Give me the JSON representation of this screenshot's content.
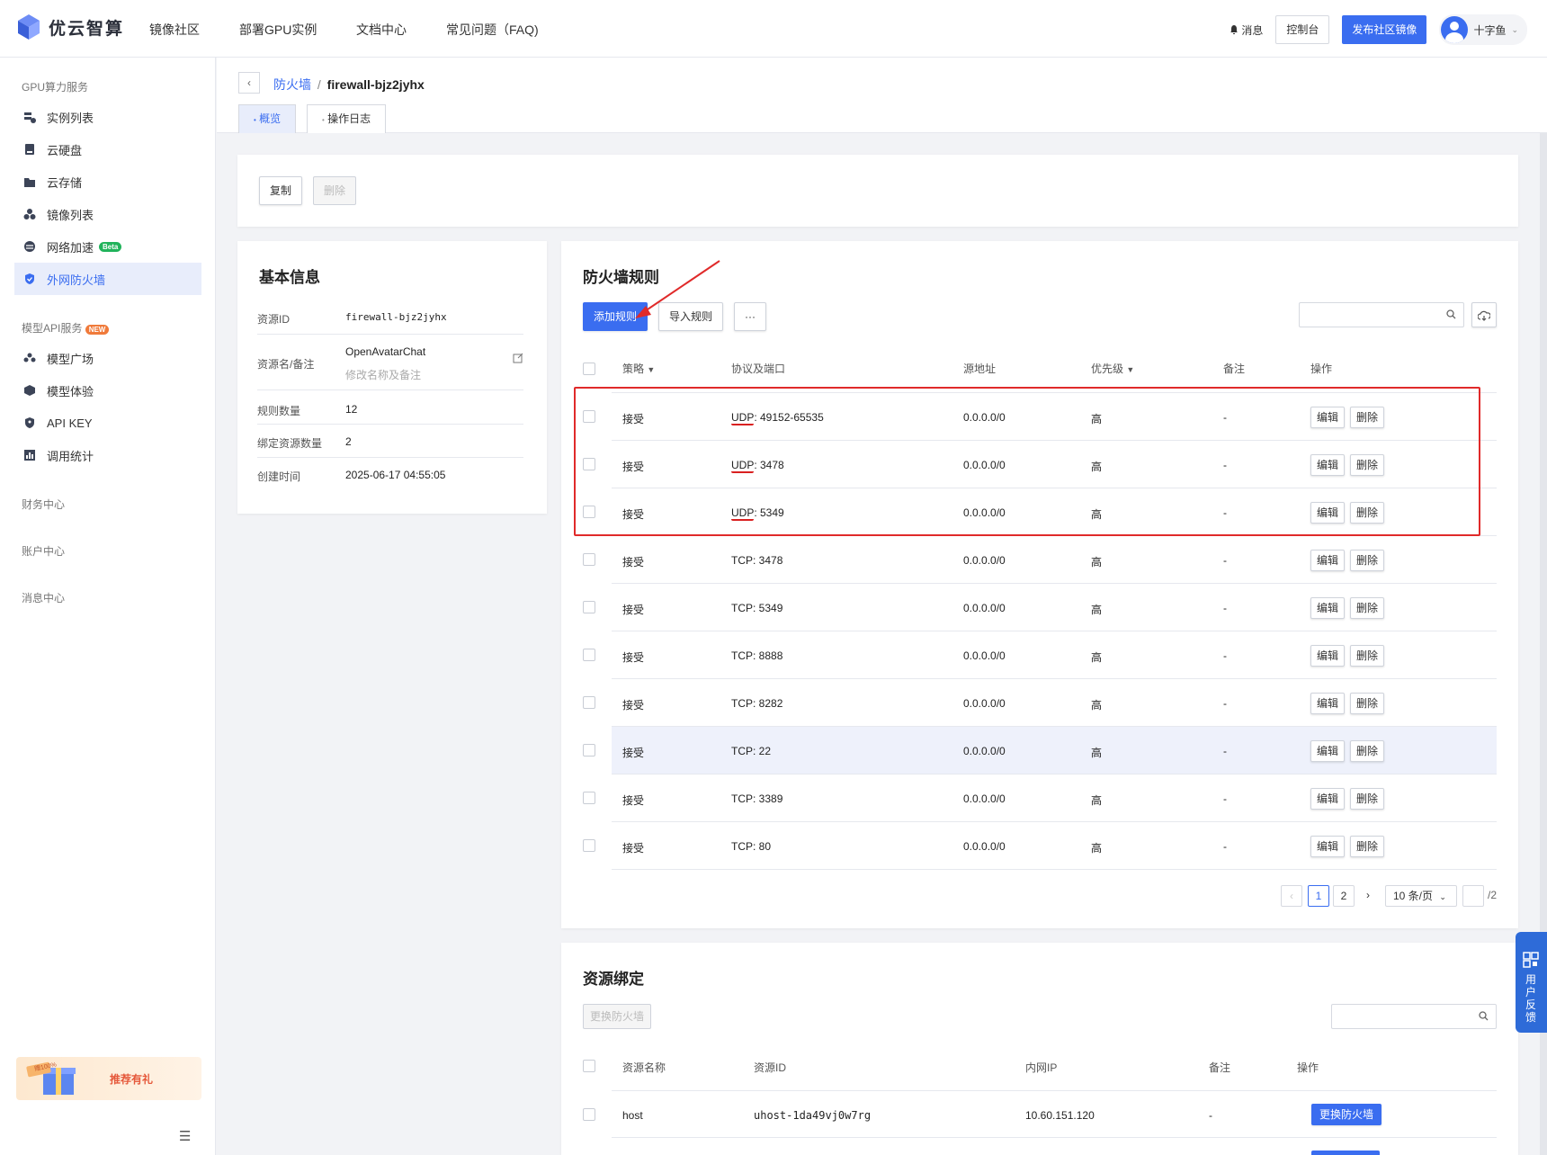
{
  "brand": {
    "name": "优云智算"
  },
  "nav": [
    {
      "label": "镜像社区"
    },
    {
      "label": "部署GPU实例"
    },
    {
      "label": "文档中心"
    },
    {
      "label": "常见问题（FAQ)"
    }
  ],
  "topright": {
    "messages": "消息",
    "console": "控制台",
    "publish": "发布社区镜像",
    "user": "十字鱼"
  },
  "sidebar": {
    "gpu_title": "GPU算力服务",
    "gpu_items": [
      {
        "label": "实例列表"
      },
      {
        "label": "云硬盘"
      },
      {
        "label": "云存储"
      },
      {
        "label": "镜像列表"
      },
      {
        "label": "网络加速",
        "badge": "Beta"
      },
      {
        "label": "外网防火墙",
        "active": true
      }
    ],
    "api_title": "模型API服务",
    "api_badge": "NEW",
    "api_items": [
      {
        "label": "模型广场"
      },
      {
        "label": "模型体验"
      },
      {
        "label": "API KEY"
      },
      {
        "label": "调用统计"
      }
    ],
    "finance": "财务中心",
    "account": "账户中心",
    "message": "消息中心",
    "promo": "推荐有礼",
    "promo_tag": "赠100%"
  },
  "header": {
    "breadcrumb_parent": "防火墙",
    "breadcrumb_sep": "/",
    "breadcrumb_current": "firewall-bjz2jyhx",
    "tabs": [
      {
        "label": "概览"
      },
      {
        "label": "操作日志"
      }
    ]
  },
  "actions": {
    "copy": "复制",
    "delete": "删除"
  },
  "basic_info": {
    "title": "基本信息",
    "resource_id_label": "资源ID",
    "resource_id": "firewall-bjz2jyhx",
    "name_label": "资源名/备注",
    "name": "OpenAvatarChat",
    "name_hint": "修改名称及备注",
    "rule_count_label": "规则数量",
    "rule_count": "12",
    "bound_label": "绑定资源数量",
    "bound": "2",
    "created_label": "创建时间",
    "created": "2025-06-17 04:55:05"
  },
  "rules": {
    "title": "防火墙规则",
    "add": "添加规则",
    "import": "导入规则",
    "more": "···",
    "columns": {
      "policy": "策略",
      "proto": "协议及端口",
      "source": "源地址",
      "priority": "优先级",
      "remark": "备注",
      "ops": "操作"
    },
    "edit": "编辑",
    "del": "删除",
    "rows": [
      {
        "policy": "接受",
        "proto": "UDP",
        "port": ": 49152-65535",
        "source": "0.0.0.0/0",
        "priority": "高",
        "remark": "-"
      },
      {
        "policy": "接受",
        "proto": "UDP",
        "port": ": 3478",
        "source": "0.0.0.0/0",
        "priority": "高",
        "remark": "-"
      },
      {
        "policy": "接受",
        "proto": "UDP",
        "port": ": 5349",
        "source": "0.0.0.0/0",
        "priority": "高",
        "remark": "-"
      },
      {
        "policy": "接受",
        "proto": "TCP",
        "port": ": 3478",
        "source": "0.0.0.0/0",
        "priority": "高",
        "remark": "-"
      },
      {
        "policy": "接受",
        "proto": "TCP",
        "port": ": 5349",
        "source": "0.0.0.0/0",
        "priority": "高",
        "remark": "-"
      },
      {
        "policy": "接受",
        "proto": "TCP",
        "port": ": 8888",
        "source": "0.0.0.0/0",
        "priority": "高",
        "remark": "-"
      },
      {
        "policy": "接受",
        "proto": "TCP",
        "port": ": 8282",
        "source": "0.0.0.0/0",
        "priority": "高",
        "remark": "-"
      },
      {
        "policy": "接受",
        "proto": "TCP",
        "port": ": 22",
        "source": "0.0.0.0/0",
        "priority": "高",
        "remark": "-"
      },
      {
        "policy": "接受",
        "proto": "TCP",
        "port": ": 3389",
        "source": "0.0.0.0/0",
        "priority": "高",
        "remark": "-"
      },
      {
        "policy": "接受",
        "proto": "TCP",
        "port": ": 80",
        "source": "0.0.0.0/0",
        "priority": "高",
        "remark": "-"
      }
    ],
    "pagination": {
      "prev": "‹",
      "p1": "1",
      "p2": "2",
      "next": "›",
      "size": "10 条/页",
      "total": "/2"
    }
  },
  "binding": {
    "title": "资源绑定",
    "change": "更换防火墙",
    "columns": {
      "name": "资源名称",
      "id": "资源ID",
      "ip": "内网IP",
      "remark": "备注",
      "ops": "操作"
    },
    "rows": [
      {
        "name": "host",
        "id": "uhost-1da49vj0w7rg",
        "ip": "10.60.151.120",
        "remark": "-",
        "action": "更换防火墙"
      }
    ]
  },
  "float": {
    "label": "用户反馈"
  }
}
